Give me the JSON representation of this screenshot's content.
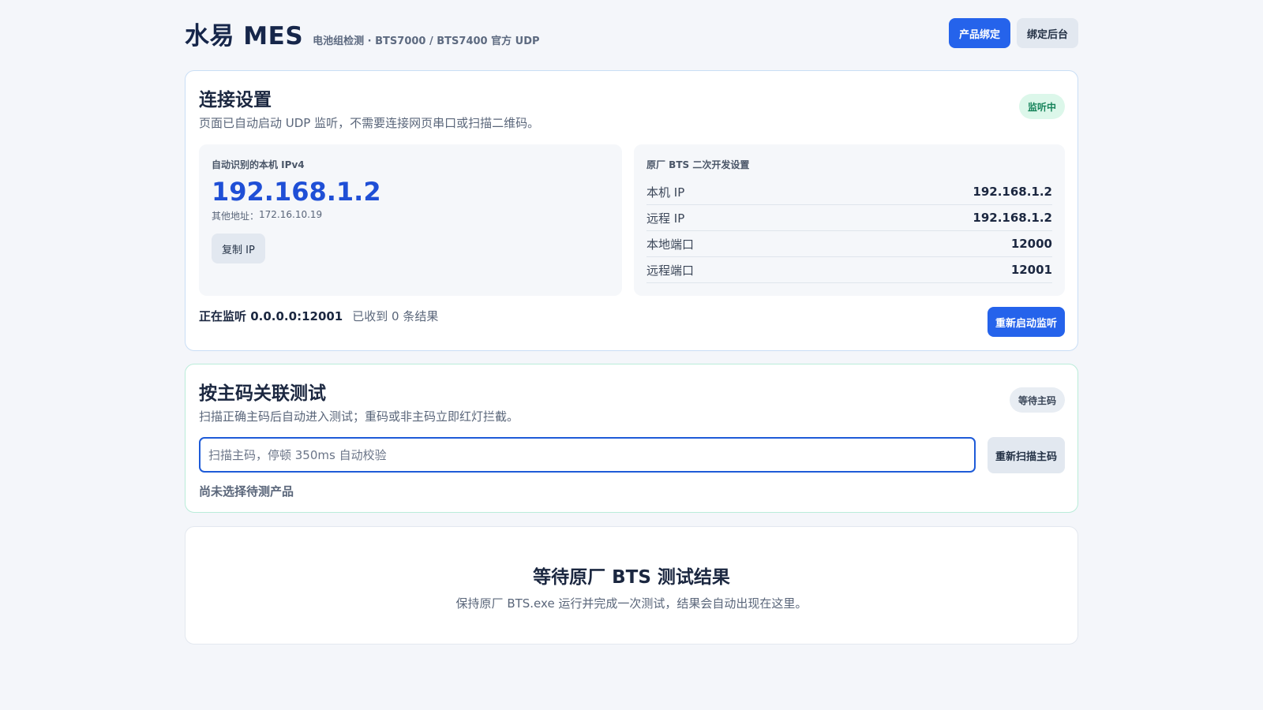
{
  "header": {
    "title": "水易 MES",
    "subtitle": "电池组检测 · BTS7000 / BTS7400 官方 UDP",
    "bind_product_label": "产品绑定",
    "bind_backend_label": "绑定后台"
  },
  "connection": {
    "title": "连接设置",
    "description": "页面已自动启动 UDP 监听，不需要连接网页串口或扫描二维码。",
    "badge": "监听中",
    "local_ip_panel": {
      "label": "自动识别的本机 IPv4",
      "ip": "192.168.1.2",
      "other_prefix": "其他地址：",
      "other_address": "172.16.10.19",
      "copy_label": "复制 IP"
    },
    "bts_panel": {
      "label": "原厂 BTS 二次开发设置",
      "rows": [
        {
          "key": "本机 IP",
          "value": "192.168.1.2"
        },
        {
          "key": "远程 IP",
          "value": "192.168.1.2"
        },
        {
          "key": "本地端口",
          "value": "12000"
        },
        {
          "key": "远程端口",
          "value": "12001"
        }
      ]
    },
    "status": "正在监听 0.0.0.0:12001",
    "received": "已收到 0 条结果",
    "restart_label": "重新启动监听"
  },
  "scan": {
    "title": "按主码关联测试",
    "description": "扫描正确主码后自动进入测试；重码或非主码立即红灯拦截。",
    "badge": "等待主码",
    "input_value": "",
    "input_placeholder": "扫描主码，停顿 350ms 自动校验",
    "rescan_label": "重新扫描主码",
    "note": "尚未选择待测产品"
  },
  "result": {
    "title": "等待原厂 BTS 测试结果",
    "description": "保持原厂 BTS.exe 运行并完成一次测试，结果会自动出现在这里。"
  },
  "colors": {
    "accent": "#2563eb",
    "ip_highlight": "#1f4fd6",
    "listening_badge_bg": "#dcf7ea",
    "listening_badge_text": "#15835a"
  }
}
